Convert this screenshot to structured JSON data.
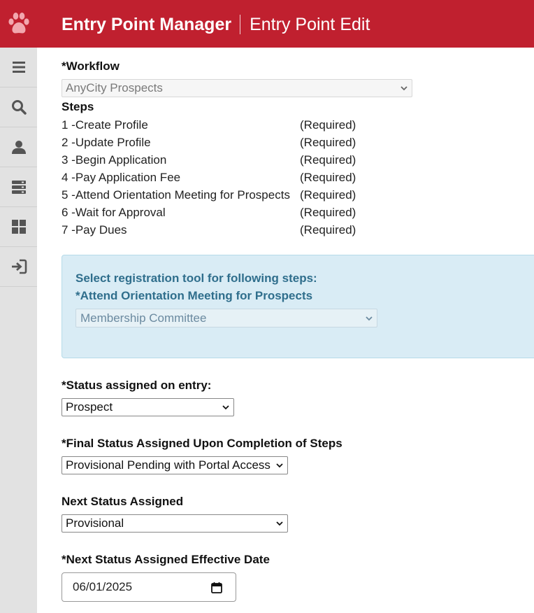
{
  "header": {
    "app_title": "Entry Point Manager",
    "page_title": "Entry Point Edit",
    "logo_icon": "paw-icon",
    "bg_color": "#c0202f"
  },
  "sidebar": {
    "items": [
      {
        "icon": "hamburger-menu-icon"
      },
      {
        "icon": "search-icon"
      },
      {
        "icon": "user-icon"
      },
      {
        "icon": "server-icon"
      },
      {
        "icon": "dashboard-icon"
      },
      {
        "icon": "sign-in-icon"
      }
    ]
  },
  "workflow": {
    "label": "*Workflow",
    "value": "AnyCity Prospects"
  },
  "steps": {
    "label": "Steps",
    "items": [
      {
        "name": "1 -Create Profile",
        "status": "(Required)"
      },
      {
        "name": "2 -Update Profile",
        "status": "(Required)"
      },
      {
        "name": "3 -Begin Application",
        "status": "(Required)"
      },
      {
        "name": "4 -Pay Application Fee",
        "status": "(Required)"
      },
      {
        "name": "5 -Attend Orientation Meeting for Prospects",
        "status": "(Required)"
      },
      {
        "name": "6 -Wait for Approval",
        "status": "(Required)"
      },
      {
        "name": "7 -Pay Dues",
        "status": "(Required)"
      }
    ]
  },
  "registration_tool": {
    "heading": "Select registration tool for following steps:",
    "step_label": "*Attend Orientation Meeting for Prospects",
    "value": "Membership Committee"
  },
  "status_on_entry": {
    "label": "*Status assigned on entry:",
    "value": "Prospect"
  },
  "final_status": {
    "label": "*Final Status Assigned Upon Completion of Steps",
    "value": "Provisional Pending with Portal Access"
  },
  "next_status": {
    "label": "Next Status Assigned",
    "value": "Provisional"
  },
  "next_status_date": {
    "label": "*Next Status Assigned Effective Date",
    "value": "06/01/2025"
  }
}
